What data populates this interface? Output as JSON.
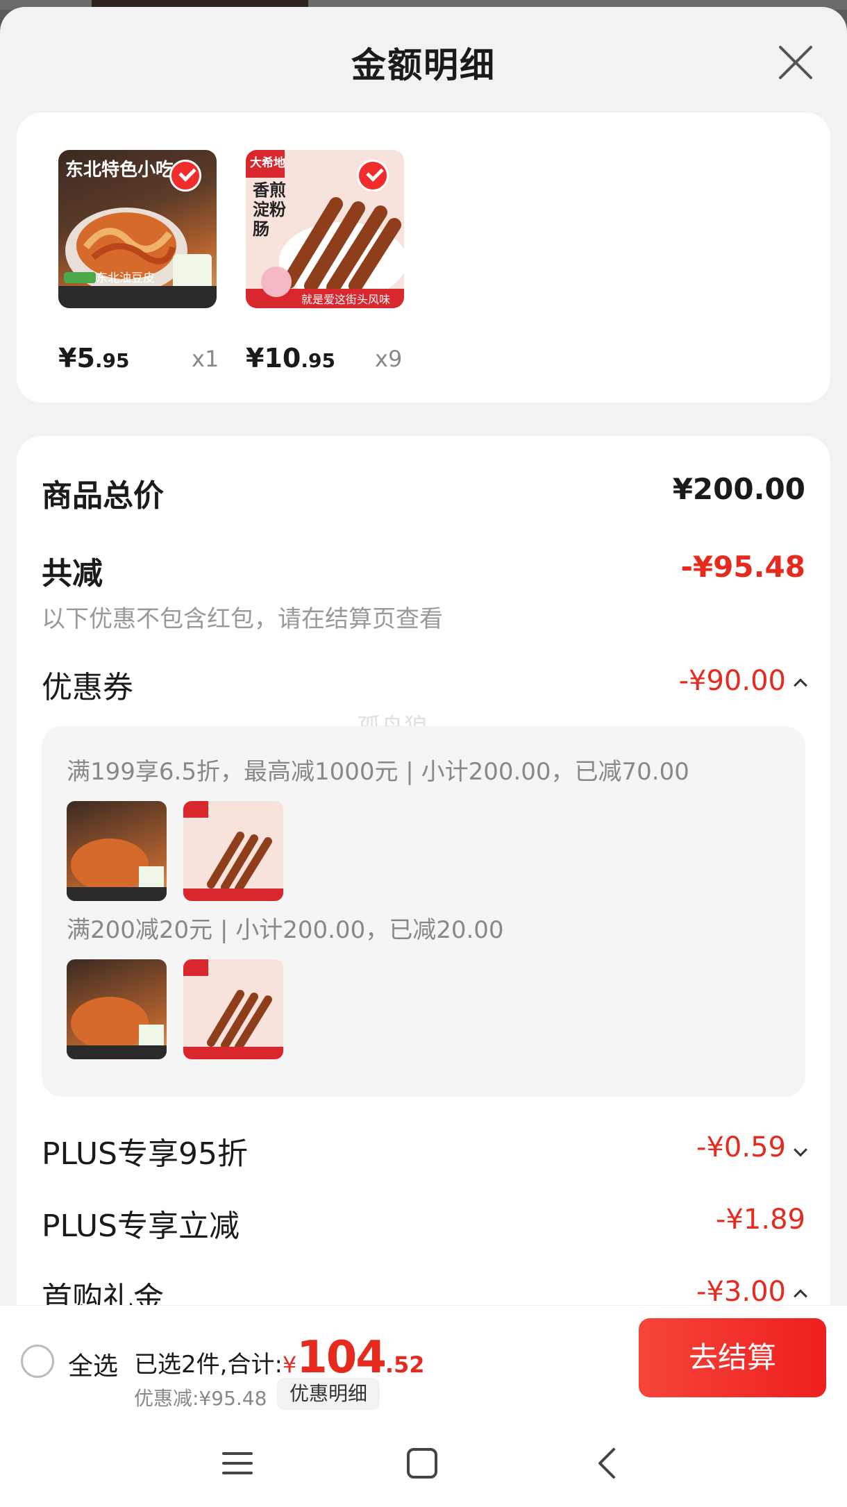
{
  "header": {
    "title": "金额明细"
  },
  "products": [
    {
      "name": "东北油豆皮",
      "thumb_text_top": "东北特色小吃",
      "thumb_text_bottom": "东北油豆皮",
      "price_int": "¥5",
      "price_dec": ".95",
      "qty": "x1",
      "checked": true
    },
    {
      "name": "香煎淀粉肠",
      "thumb_text_top": "大希地",
      "thumb_text_mid": "香煎淀粉肠",
      "thumb_text_bottom": "就是爱这街头风味",
      "price_int": "¥10",
      "price_dec": ".95",
      "qty": "x9",
      "checked": true
    }
  ],
  "summary_rows": {
    "total_label": "商品总价",
    "total_value": "¥200.00",
    "reduce_label": "共减",
    "reduce_value": "-¥95.48",
    "reduce_note": "以下优惠不包含红包，请在结算页查看",
    "coupon_label": "优惠券",
    "coupon_value": "-¥90.00",
    "plus95_label": "PLUS专享95折",
    "plus95_value": "-¥0.59",
    "plus_cut_label": "PLUS专享立减",
    "plus_cut_value": "-¥1.89",
    "first_gift_label": "首购礼金",
    "first_gift_value": "-¥3.00"
  },
  "coupon_details": [
    {
      "text": "满199享6.5折，最高减1000元 | 小计200.00，已减70.00"
    },
    {
      "text": "满200减20元 | 小计200.00，已减20.00"
    }
  ],
  "watermark": "孤舟狼",
  "bottom_bar": {
    "select_all": "全选",
    "selected_text": "已选2件,合计:",
    "currency": "¥",
    "total_int": "104",
    "total_dec": ".52",
    "discount_text": "优惠减:¥95.48",
    "detail_button": "优惠明细",
    "checkout_button": "去结算"
  },
  "colors": {
    "accent": "#e62a1e",
    "checkout": "#f02c2c"
  }
}
